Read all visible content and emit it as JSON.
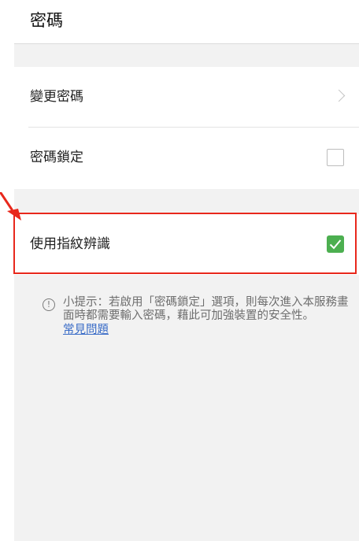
{
  "header": {
    "title": "密碼"
  },
  "settings": {
    "change_password": {
      "label": "變更密碼"
    },
    "password_lock": {
      "label": "密碼鎖定",
      "checked": false
    },
    "fingerprint": {
      "label": "使用指紋辨識",
      "checked": true
    }
  },
  "hint": {
    "icon": "info-circle-icon",
    "icon_glyph": "!",
    "text": "小提示：若啟用「密碼鎖定」選項，則每次進入本服務畫面時都需要輸入密碼，藉此可加強裝置的安全性。",
    "link": "常見問題"
  },
  "colors": {
    "accent_green": "#4caf50",
    "highlight_red": "#e8281c",
    "link_blue": "#3a6cc7"
  }
}
